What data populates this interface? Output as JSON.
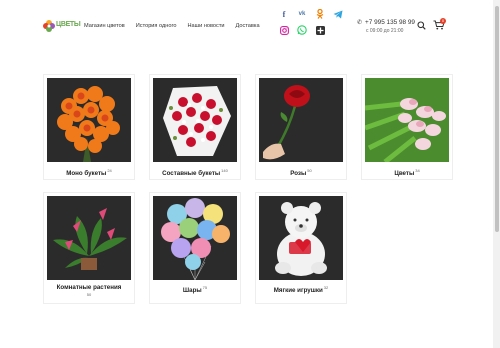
{
  "header": {
    "logo_text": "ЦВЕТЫ",
    "nav": [
      {
        "label": "Магазин цветов"
      },
      {
        "label": "История одного"
      },
      {
        "label": "Наши новости"
      },
      {
        "label": "Доставка"
      }
    ],
    "social_icons": [
      "facebook-icon",
      "vk-icon",
      "odnoklassniki-icon",
      "telegram-icon",
      "instagram-icon",
      "whatsapp-icon",
      "gallery-icon"
    ],
    "phone": "+7 995 135 98 99",
    "hours": "с 09:00 до 21:00",
    "cart_count": "0"
  },
  "categories": [
    {
      "name": "Моно букеты",
      "count": "24"
    },
    {
      "name": "Составные букеты",
      "count": "140"
    },
    {
      "name": "Розы",
      "count": "50"
    },
    {
      "name": "Цветы",
      "count": "34"
    },
    {
      "name": "Комнатные растения",
      "count": "50"
    },
    {
      "name": "Шары",
      "count": "75"
    },
    {
      "name": "Мягкие игрушки",
      "count": "32"
    }
  ],
  "colors": {
    "accent": "#e5412a",
    "facebook": "#3b5998",
    "vk": "#4a76a8",
    "ok": "#ee8208",
    "telegram": "#2ca5e0",
    "instagram": "#d6249f",
    "whatsapp": "#25d366"
  }
}
